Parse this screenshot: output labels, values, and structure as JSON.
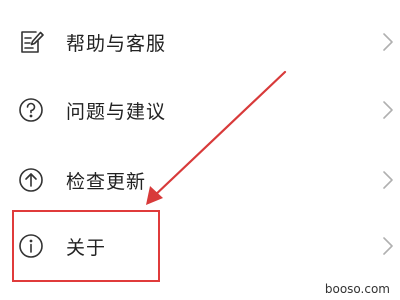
{
  "menu": {
    "items": [
      {
        "label": "帮助与客服",
        "icon": "edit-document-icon"
      },
      {
        "label": "问题与建议",
        "icon": "question-circle-icon"
      },
      {
        "label": "检查更新",
        "icon": "arrow-up-circle-icon"
      },
      {
        "label": "关于",
        "icon": "info-circle-icon"
      }
    ]
  },
  "annotation": {
    "highlight_color": "#e03b3b",
    "arrow_color": "#d83a3a",
    "highlighted_item": "关于"
  },
  "watermark": "booso.com",
  "colors": {
    "background": "#ffffff",
    "text": "#222222",
    "icon": "#333333",
    "chevron": "#b0b0b0"
  }
}
